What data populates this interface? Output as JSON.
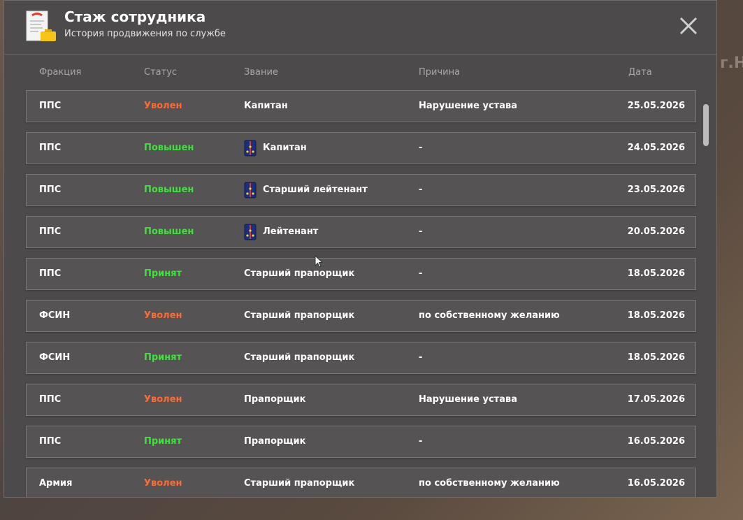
{
  "background": {
    "partial_text": "г.Н"
  },
  "header": {
    "title": "Стаж сотрудника",
    "subtitle": "История продвижения по службе"
  },
  "columns": {
    "faction": "Фракция",
    "status": "Статус",
    "rank": "Звание",
    "reason": "Причина",
    "date": "Дата"
  },
  "colors": {
    "dismissed": "#ff6a33",
    "promoted": "#3ee23a",
    "panel": "#4c4a4b",
    "row": "#555354"
  },
  "rows": [
    {
      "faction": "ППС",
      "status": "Уволен",
      "status_type": "red",
      "rank": "Капитан",
      "rank_icon": false,
      "reason": "Нарушение устава",
      "date": "25.05.2026"
    },
    {
      "faction": "ППС",
      "status": "Повышен",
      "status_type": "green",
      "rank": "Капитан",
      "rank_icon": true,
      "reason": "-",
      "date": "24.05.2026"
    },
    {
      "faction": "ППС",
      "status": "Повышен",
      "status_type": "green",
      "rank": "Старший лейтенант",
      "rank_icon": true,
      "reason": "-",
      "date": "23.05.2026"
    },
    {
      "faction": "ППС",
      "status": "Повышен",
      "status_type": "green",
      "rank": "Лейтенант",
      "rank_icon": true,
      "reason": "-",
      "date": "20.05.2026"
    },
    {
      "faction": "ППС",
      "status": "Принят",
      "status_type": "green",
      "rank": "Старший прапорщик",
      "rank_icon": false,
      "reason": "-",
      "date": "18.05.2026"
    },
    {
      "faction": "ФСИН",
      "status": "Уволен",
      "status_type": "red",
      "rank": "Старший прапорщик",
      "rank_icon": false,
      "reason": "по собственному желанию",
      "date": "18.05.2026"
    },
    {
      "faction": "ФСИН",
      "status": "Принят",
      "status_type": "green",
      "rank": "Старший прапорщик",
      "rank_icon": false,
      "reason": "-",
      "date": "18.05.2026"
    },
    {
      "faction": "ППС",
      "status": "Уволен",
      "status_type": "red",
      "rank": "Прапорщик",
      "rank_icon": false,
      "reason": "Нарушение устава",
      "date": "17.05.2026"
    },
    {
      "faction": "ППС",
      "status": "Принят",
      "status_type": "green",
      "rank": "Прапорщик",
      "rank_icon": false,
      "reason": "-",
      "date": "16.05.2026"
    },
    {
      "faction": "Армия",
      "status": "Уволен",
      "status_type": "red",
      "rank": "Старший прапорщик",
      "rank_icon": false,
      "reason": "по собственному желанию",
      "date": "16.05.2026"
    }
  ]
}
